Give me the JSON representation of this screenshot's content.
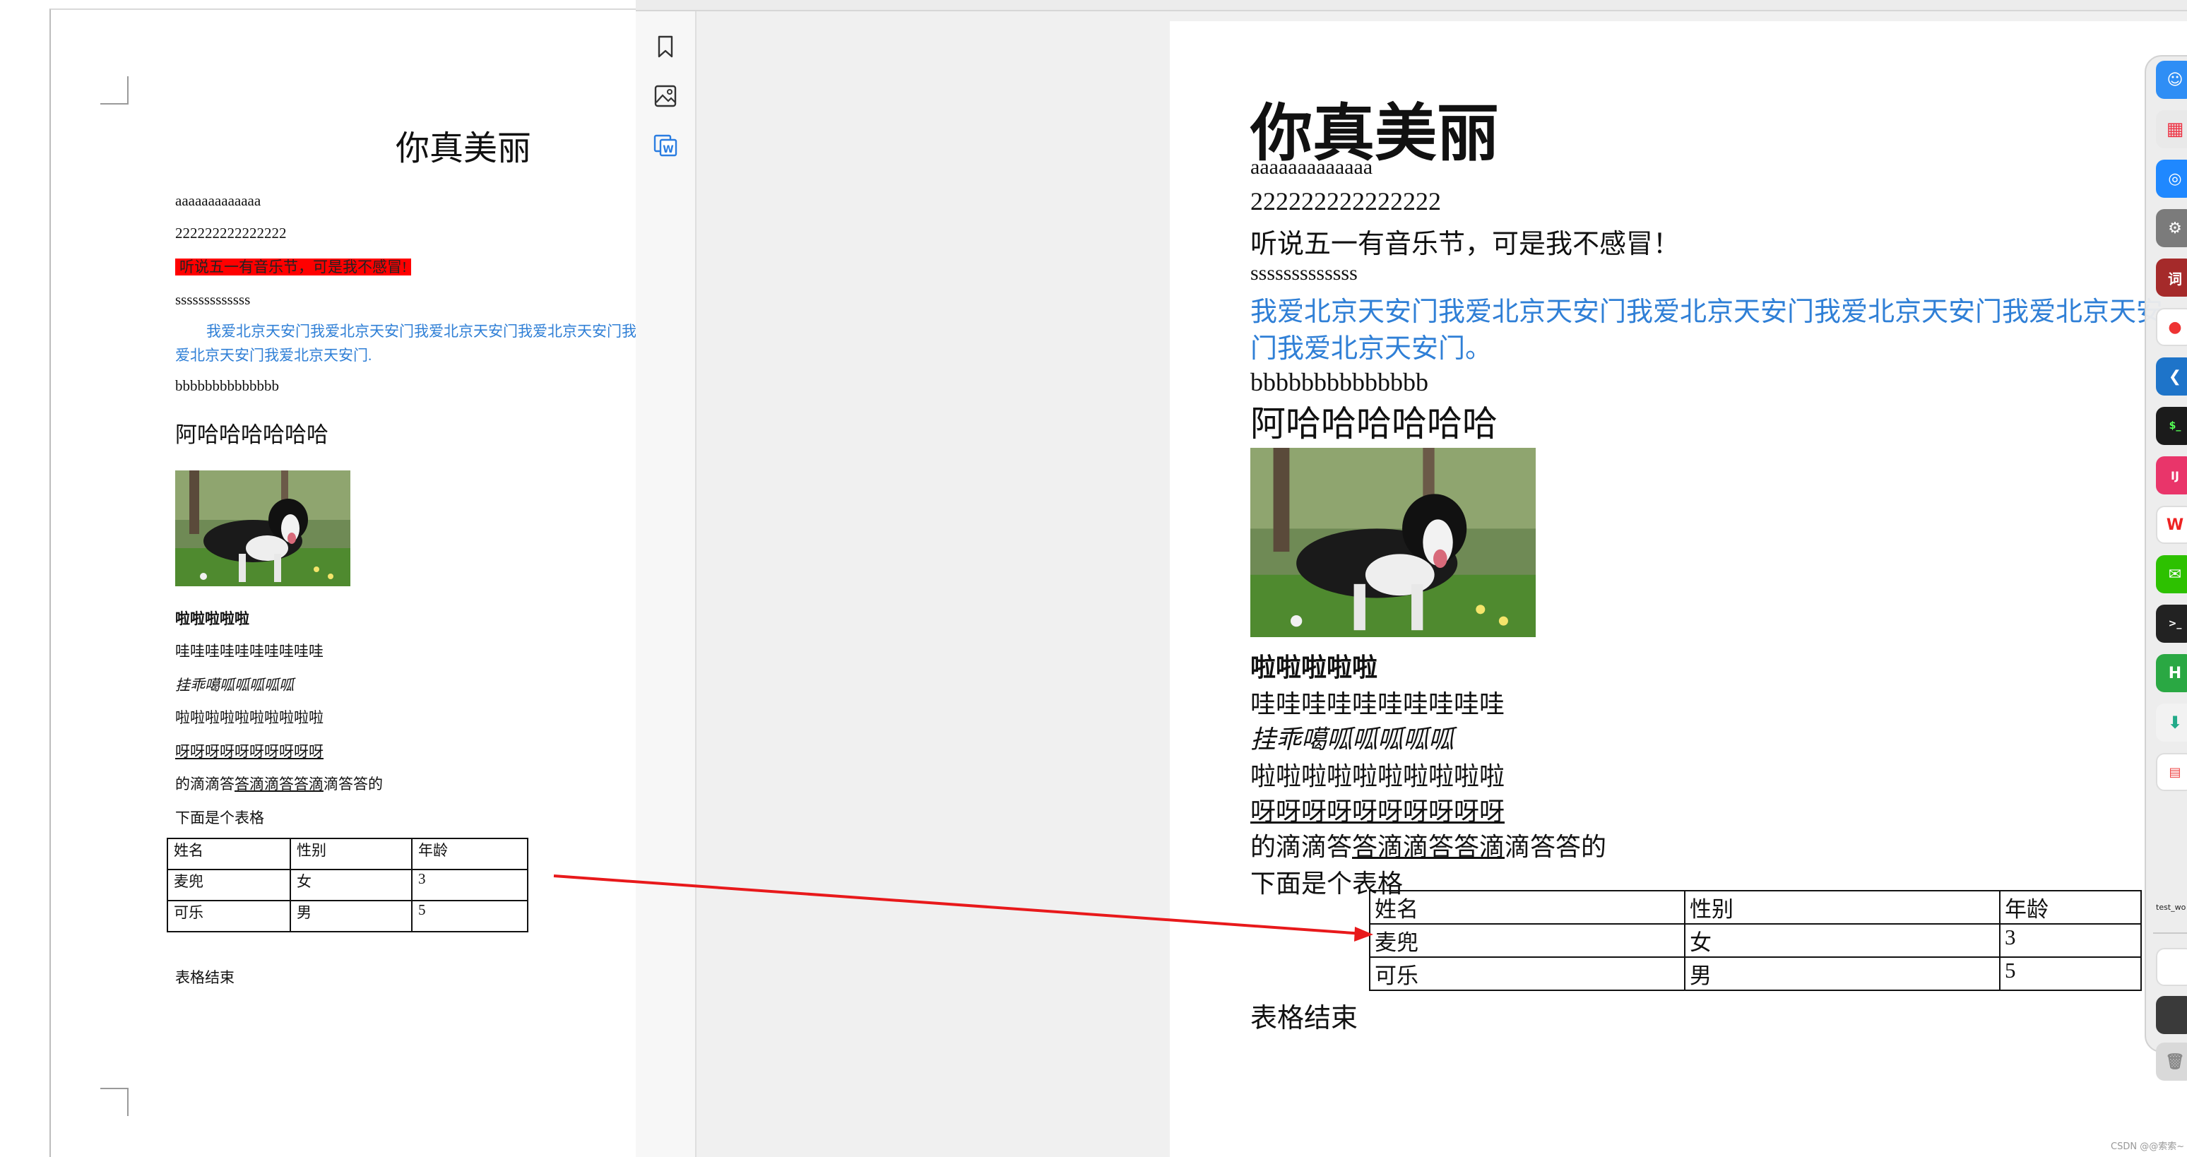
{
  "colors": {
    "accent_blue": "#2f7fd6",
    "highlight_red": "#ff0000",
    "arrow_red": "#e8191b"
  },
  "document": {
    "title": "你真美丽",
    "lines": {
      "a": "aaaaaaaaaaaaa",
      "two": "222222222222222",
      "red": "听说五一有音乐节，可是我不感冒!",
      "red_right": "听说五一有音乐节，可是我不感冒！",
      "s": "sssssssssssss",
      "blue_left": "我爱北京天安门我爱北京天安门我爱北京天安门我爱北京天安门我爱北京天安门我爱北京天安门.",
      "blue_right": "我爱北京天安门我爱北京天安门我爱北京天安门我爱北京天安门我爱北京天安门我爱北京天安门。",
      "b": "bbbbbbbbbbbbbb",
      "heading": "阿哈哈哈哈哈哈",
      "bold": "啦啦啦啦啦",
      "wa": "哇哇哇哇哇哇哇哇哇哇",
      "italic": "挂乖噶呱呱呱呱呱",
      "la": "啦啦啦啦啦啦啦啦啦啦",
      "ya": "呀呀呀呀呀呀呀呀呀呀",
      "drip_part1": "的滴滴答",
      "drip_part2": "答滴滴答答滴",
      "drip_part3": "滴答答的",
      "table_intro": "下面是个表格",
      "table_end": "表格结束"
    },
    "table": {
      "headers": [
        "姓名",
        "性别",
        "年龄"
      ],
      "rows": [
        [
          "麦兜",
          "女",
          "3"
        ],
        [
          "可乐",
          "男",
          "5"
        ]
      ]
    }
  },
  "viewer_toolbar": {
    "icons": [
      "bookmark-icon",
      "image-icon",
      "word-convert-icon"
    ]
  },
  "dock": {
    "label": "test_wo"
  },
  "watermark": "CSDN @@索索~"
}
